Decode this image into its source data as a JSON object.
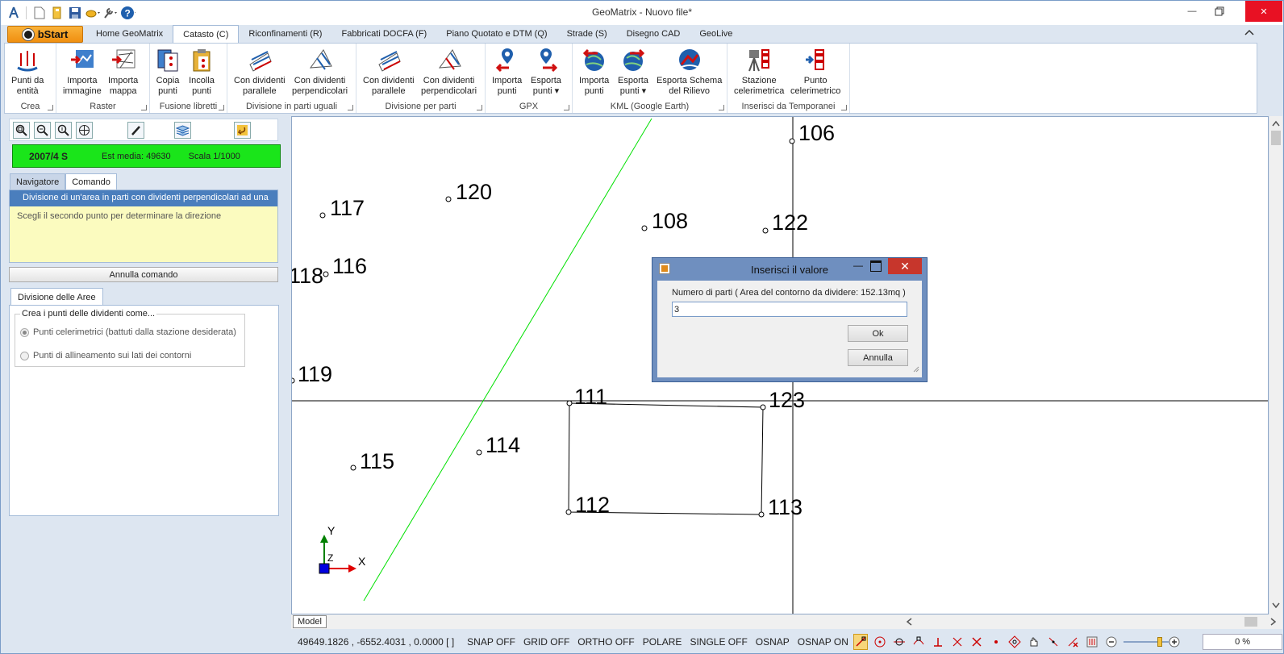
{
  "window": {
    "title": "GeoMatrix - Nuovo file*"
  },
  "start_button": "bStart",
  "ribbon_tabs": [
    "Home GeoMatrix",
    "Catasto (C)",
    "Riconfinamenti (R)",
    "Fabbricati DOCFA (F)",
    "Piano Quotato e DTM (Q)",
    "Strade (S)",
    "Disegno CAD",
    "GeoLive"
  ],
  "active_tab": "Catasto (C)",
  "ribbon": {
    "crea": {
      "label": "Crea",
      "b1l1": "Punti da",
      "b1l2": "entità"
    },
    "raster": {
      "label": "Raster",
      "b1l1": "Importa",
      "b1l2": "immagine",
      "b2l1": "Importa",
      "b2l2": "mappa"
    },
    "fusione": {
      "label": "Fusione libretti",
      "b1l1": "Copia",
      "b1l2": "punti",
      "b2l1": "Incolla",
      "b2l2": "punti"
    },
    "divuguali": {
      "label": "Divisione in parti uguali",
      "b1l1": "Con dividenti",
      "b1l2": "parallele",
      "b2l1": "Con dividenti",
      "b2l2": "perpendicolari"
    },
    "divparti": {
      "label": "Divisione per parti",
      "b1l1": "Con dividenti",
      "b1l2": "parallele",
      "b2l1": "Con dividenti",
      "b2l2": "perpendicolari"
    },
    "gpx": {
      "label": "GPX",
      "b1l1": "Importa",
      "b1l2": "punti",
      "b2l1": "Esporta",
      "b2l2": "punti"
    },
    "kml": {
      "label": "KML (Google Earth)",
      "b1l1": "Importa",
      "b1l2": "punti",
      "b2l1": "Esporta",
      "b2l2": "punti",
      "b3l1": "Esporta Schema",
      "b3l2": "del Rilievo"
    },
    "temp": {
      "label": "Inserisci da Temporanei",
      "b1l1": "Stazione",
      "b1l2": "celerimetrica",
      "b2l1": "Punto",
      "b2l2": "celerimetrico"
    }
  },
  "info_bar": {
    "sheet": "2007/4 S",
    "est": "Est media: 49630",
    "scale": "Scala 1/1000"
  },
  "panel_tabs": [
    "Navigatore",
    "Comando"
  ],
  "command": {
    "title": "Divisione di un'area in parti con dividenti perpendicolari ad una",
    "hint": "Scegli il secondo punto per determinare la direzione",
    "cancel": "Annulla comando"
  },
  "division": {
    "tab": "Divisione delle Aree",
    "legend": "Crea i punti delle dividenti come...",
    "opt1": "Punti celerimetrici (battuti dalla stazione desiderata)",
    "opt2": "Punti di allineamento sui lati dei contorni"
  },
  "points": [
    "106",
    "117",
    "120",
    "108",
    "122",
    "118",
    "116",
    "119",
    "111",
    "123",
    "114",
    "115",
    "112",
    "113"
  ],
  "axes": {
    "x": "X",
    "y": "Y",
    "z": "Z"
  },
  "model_tab": "Model",
  "status": {
    "coords": "49649.1826 , -6552.4031 , 0.0000 [ ]",
    "snap": "SNAP OFF",
    "grid": "GRID OFF",
    "ortho": "ORTHO OFF",
    "polare": "POLARE",
    "single": "SINGLE OFF",
    "osnap": "OSNAP",
    "osnapon": "OSNAP ON",
    "percent": "0 %"
  },
  "dialog": {
    "title": "Inserisci il valore",
    "label": "Numero di parti ( Area del contorno da dividere: 152.13mq )",
    "value": "3",
    "ok": "Ok",
    "cancel": "Annulla"
  },
  "colors": {
    "accent": "#4a7ebd",
    "info_bar": "#1ae51a",
    "guide_line": "#00e000",
    "close": "#e81123"
  }
}
